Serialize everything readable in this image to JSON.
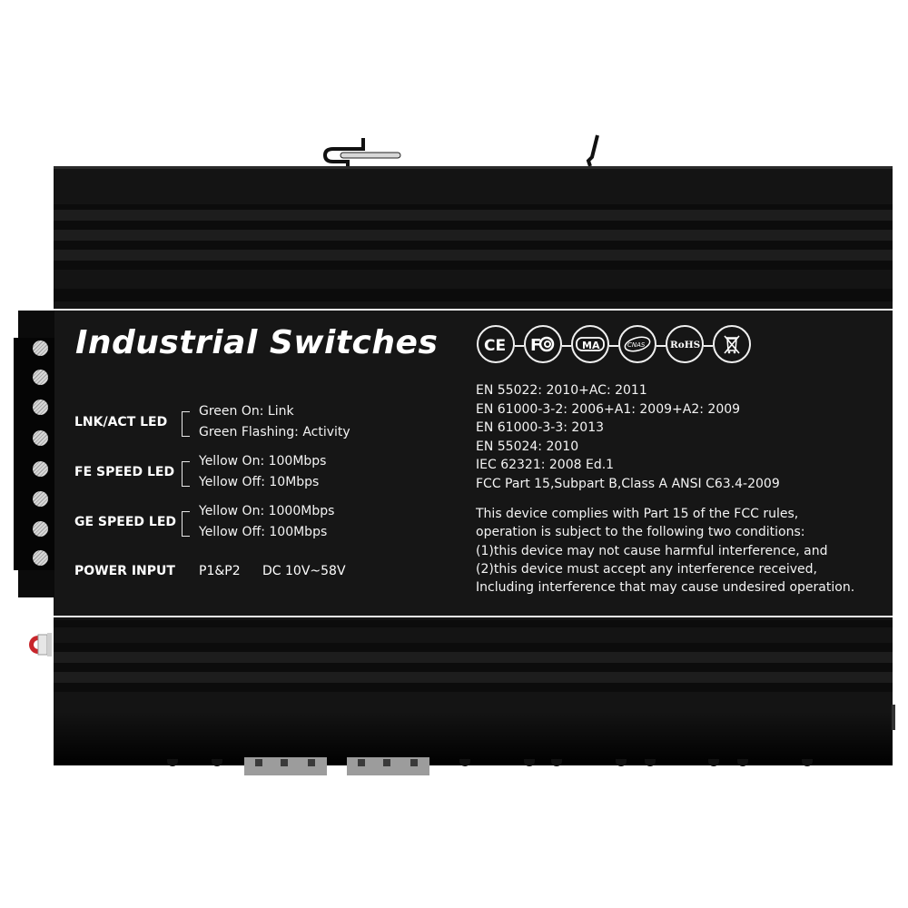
{
  "device": {
    "title": "Industrial Switches",
    "led_indicators": [
      {
        "name": "LNK/ACT LED",
        "states": [
          "Green On: Link",
          "Green Flashing: Activity"
        ]
      },
      {
        "name": "FE SPEED LED",
        "states": [
          "Yellow On: 100Mbps",
          "Yellow Off: 10Mbps"
        ]
      },
      {
        "name": "GE SPEED LED",
        "states": [
          "Yellow On: 1000Mbps",
          "Yellow Off: 100Mbps"
        ]
      }
    ],
    "power_input": {
      "name": "POWER INPUT",
      "ports": "P1&P2",
      "voltage": "DC 10V~58V"
    },
    "certifications": [
      {
        "icon": "ce-mark-icon",
        "label": "CE"
      },
      {
        "icon": "fcc-mark-icon",
        "label": "FC"
      },
      {
        "icon": "cma-mark-icon",
        "label": "MA"
      },
      {
        "icon": "cnas-mark-icon",
        "label": "CNAS"
      },
      {
        "icon": "rohs-mark-icon",
        "label": "RoHS"
      },
      {
        "icon": "weee-bin-icon",
        "label": ""
      }
    ],
    "standards": [
      "EN 55022: 2010+AC: 2011",
      "EN 61000-3-2: 2006+A1: 2009+A2: 2009",
      "EN 61000-3-3: 2013",
      "EN 55024: 2010",
      "IEC 62321: 2008 Ed.1",
      "FCC Part 15,Subpart B,Class A ANSI C63.4-2009"
    ],
    "fcc_notice": [
      "This device complies with Part 15 of the FCC rules,",
      "operation is subject to the following two conditions:",
      "(1)this device may not cause harmful interference, and",
      "(2)this device must accept any interference received,",
      "Including interference that may cause undesired operation."
    ],
    "colors": {
      "body": "#141414",
      "text": "#ffffff",
      "reset_button": "#c8252b",
      "screw": "#c8c8c8"
    }
  }
}
